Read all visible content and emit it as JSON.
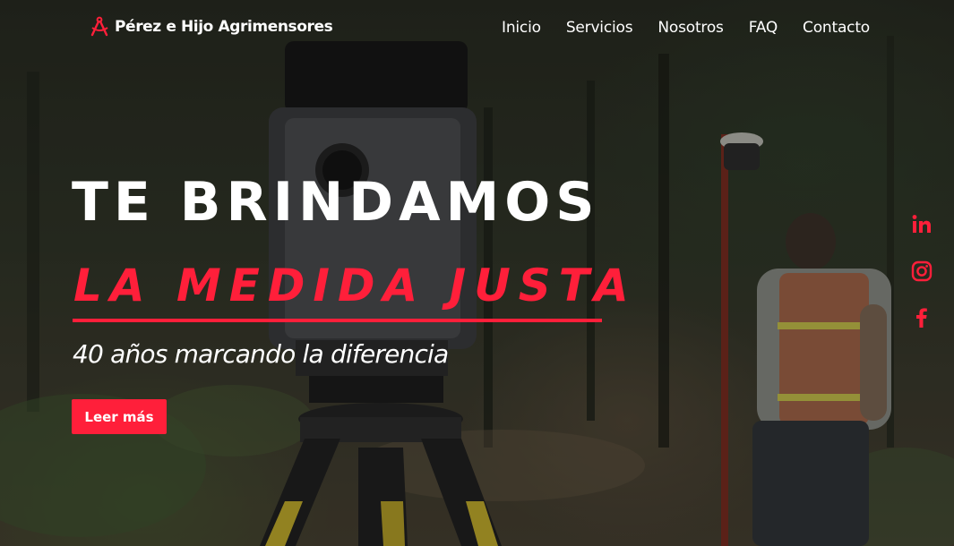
{
  "brand": {
    "name": "Pérez e Hijo Agrimensores",
    "icon": "compass-icon"
  },
  "nav": {
    "items": [
      {
        "label": "Inicio"
      },
      {
        "label": "Servicios"
      },
      {
        "label": "Nosotros"
      },
      {
        "label": "FAQ"
      },
      {
        "label": "Contacto"
      }
    ]
  },
  "hero": {
    "headline_line1": "TE BRINDAMOS",
    "headline_line2": "LA MEDIDA JUSTA",
    "tagline": "40 años marcando la diferencia",
    "cta_label": "Leer más"
  },
  "social": [
    {
      "icon": "linkedin-icon"
    },
    {
      "icon": "instagram-icon"
    },
    {
      "icon": "facebook-icon"
    }
  ],
  "colors": {
    "accent": "#ff1f3a",
    "text": "#ffffff"
  }
}
